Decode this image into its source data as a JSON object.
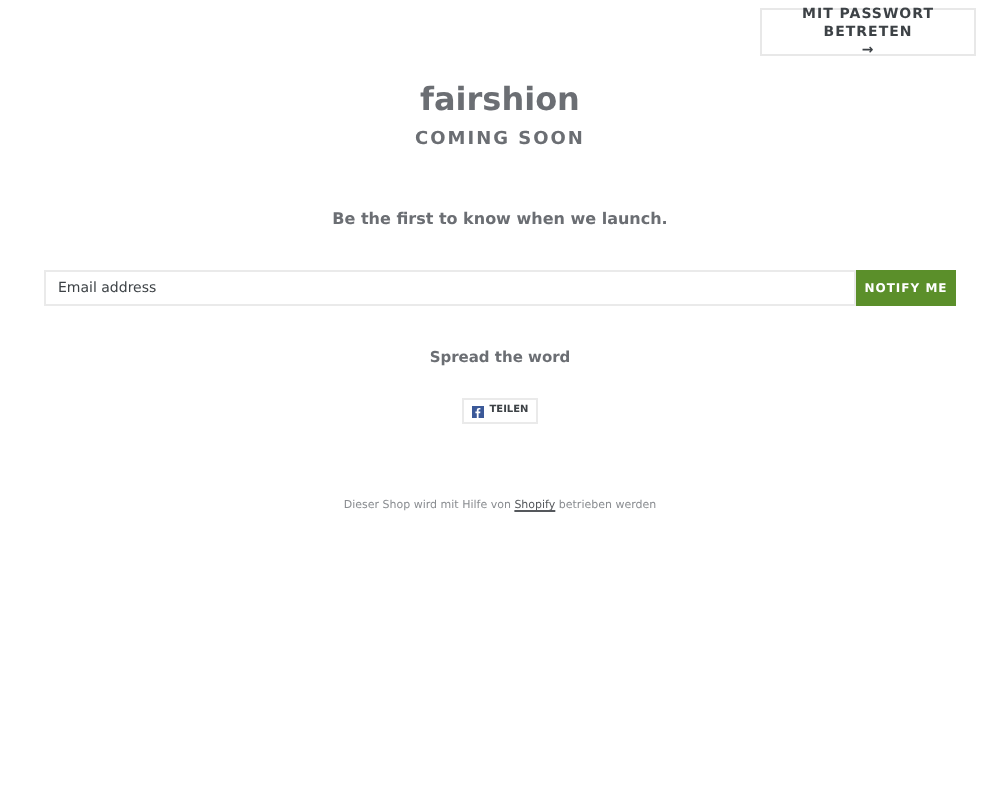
{
  "password_button": {
    "label": "MIT PASSWORT BETRETEN",
    "arrow": "→"
  },
  "header": {
    "title": "fairshion",
    "subtitle": "COMING SOON"
  },
  "tagline": "Be the first to know when we launch.",
  "signup": {
    "placeholder": "Email address",
    "button": "NOTIFY ME"
  },
  "share": {
    "heading": "Spread the word",
    "button": "TEILEN"
  },
  "footer": {
    "before": "Dieser Shop wird mit Hilfe von ",
    "link": "Shopify",
    "after": " betrieben werden"
  }
}
